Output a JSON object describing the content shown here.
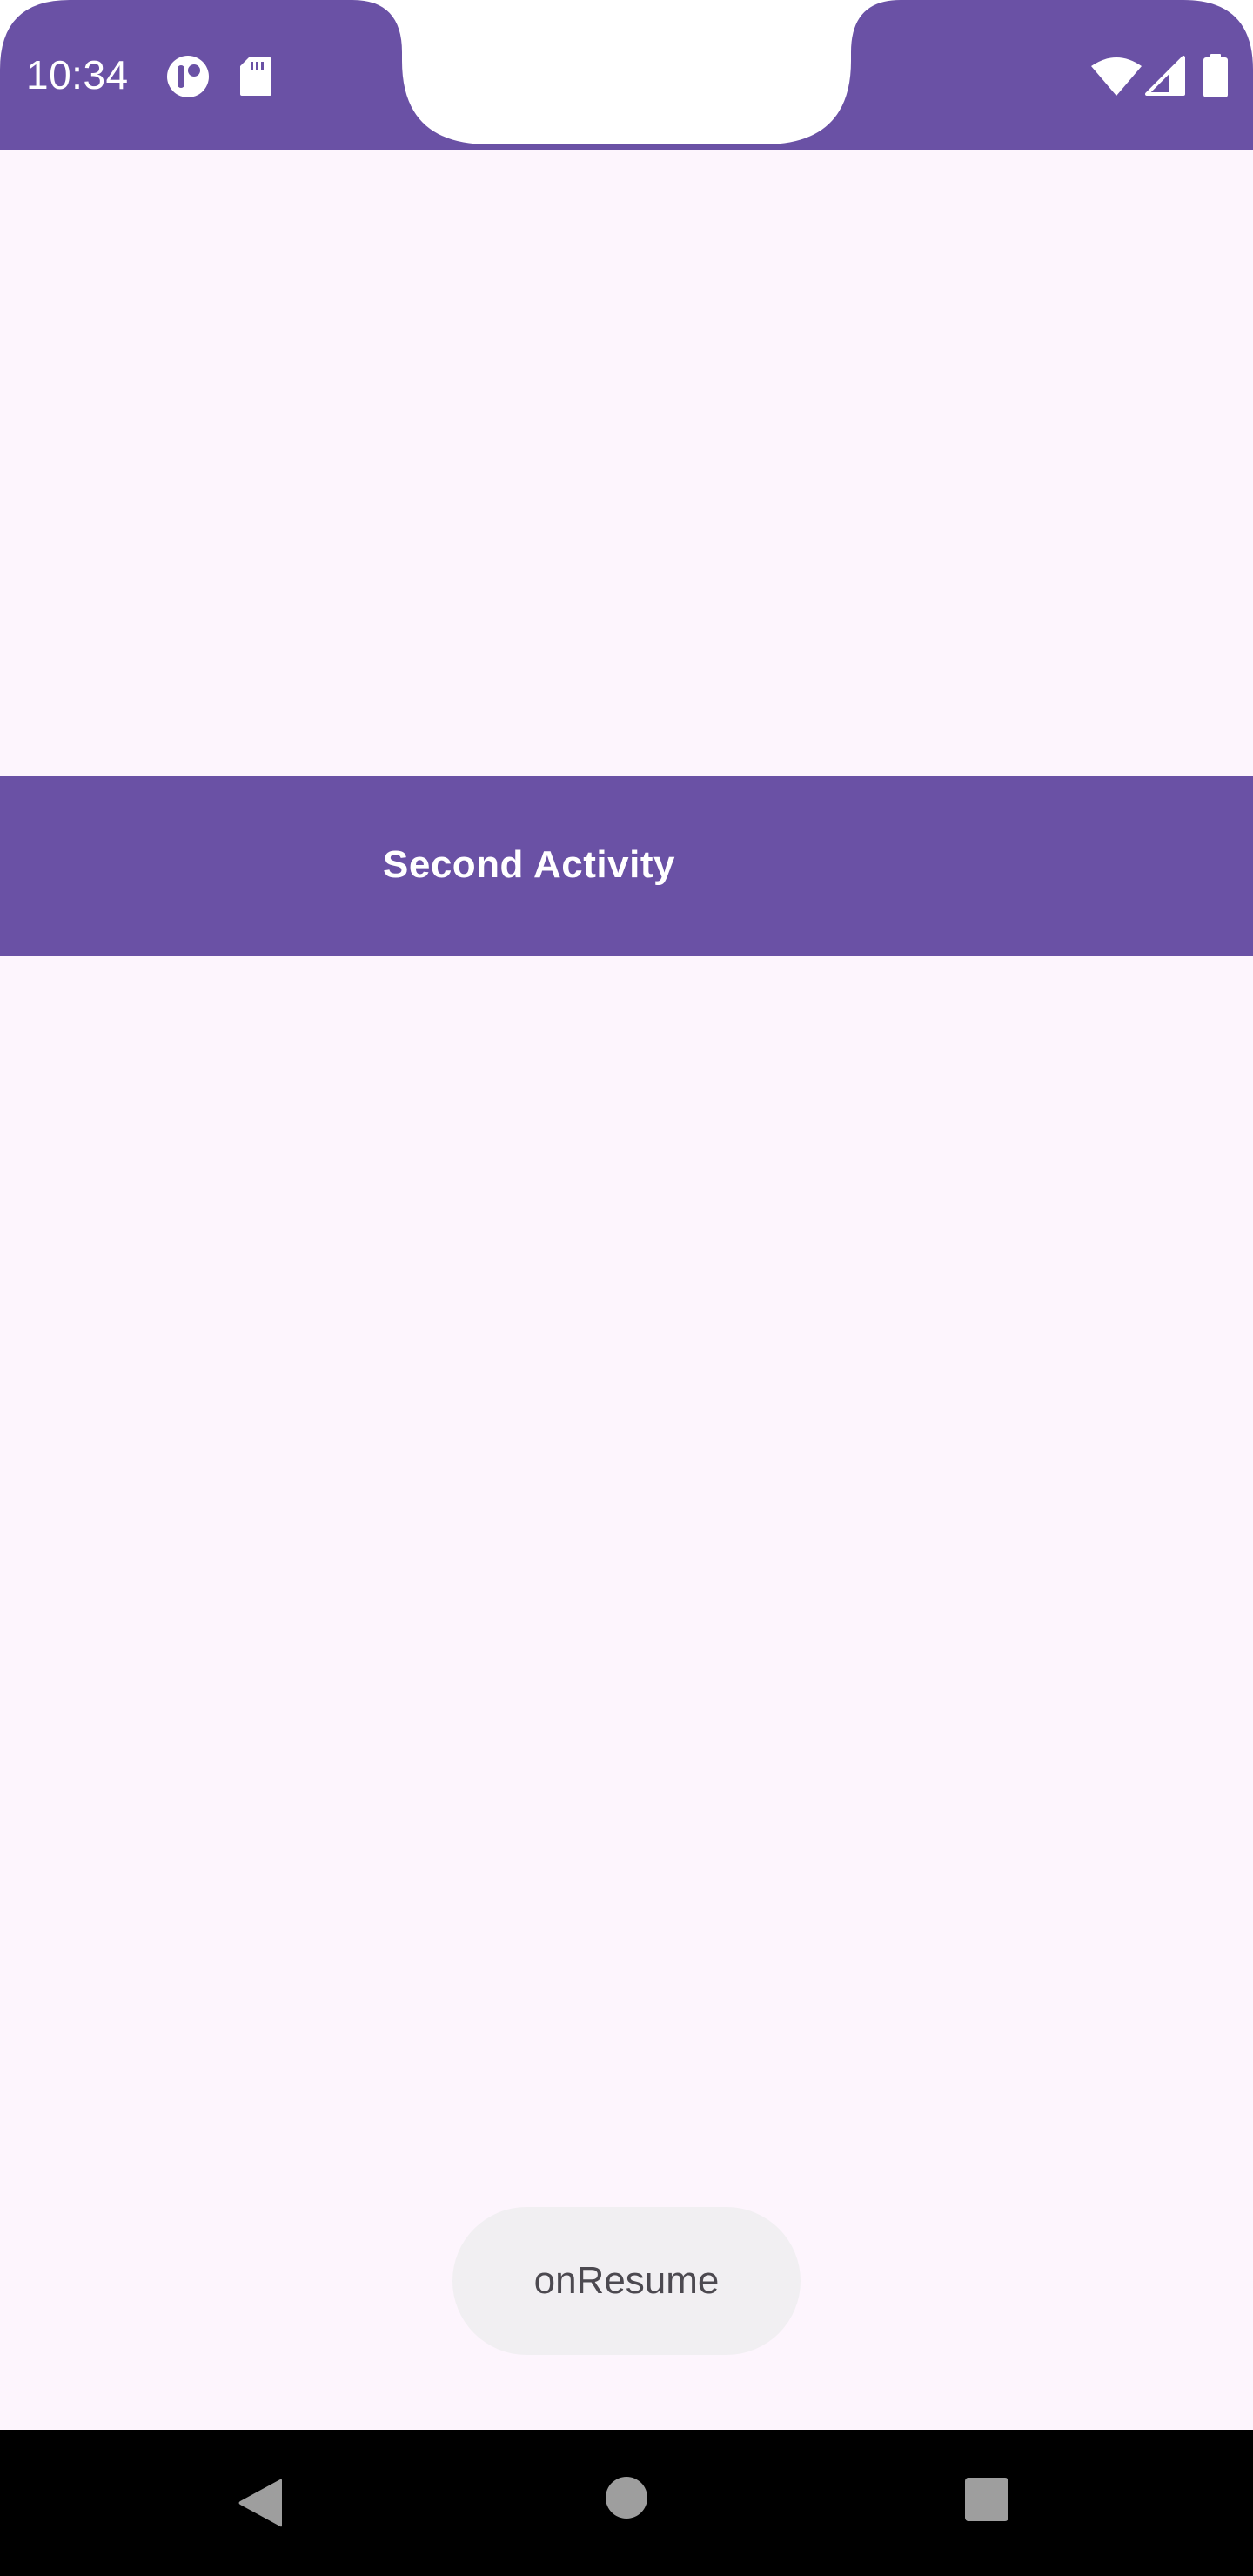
{
  "status_bar": {
    "time": "10:34",
    "icons": [
      "assistant-icon",
      "sd-card-icon",
      "wifi-icon",
      "signal-icon",
      "battery-icon"
    ],
    "color": "#6a51a5"
  },
  "activity": {
    "title": "Second Activity",
    "color": "#6a51a5"
  },
  "toast": {
    "text": "onResume"
  },
  "nav_bar": {
    "buttons": [
      "back-icon",
      "home-icon",
      "recents-icon"
    ]
  },
  "colors": {
    "background": "#fdf5fd",
    "primary": "#6a51a5",
    "toast_bg": "#f1eff2",
    "nav_bg": "#000000"
  }
}
